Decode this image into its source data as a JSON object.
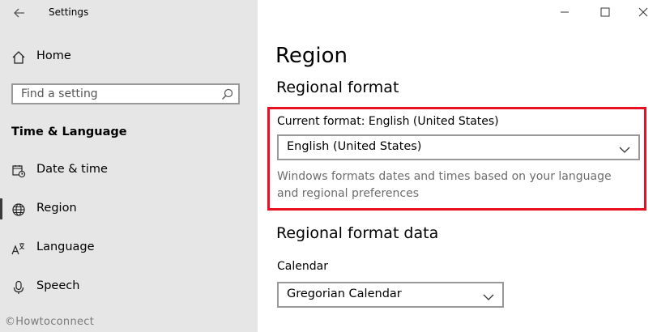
{
  "window": {
    "title": "Settings"
  },
  "sidebar": {
    "home_label": "Home",
    "search_placeholder": "Find a setting",
    "section_title": "Time & Language",
    "items": [
      {
        "label": "Date & time",
        "icon": "calendar-clock-icon"
      },
      {
        "label": "Region",
        "icon": "globe-icon",
        "selected": true
      },
      {
        "label": "Language",
        "icon": "language-icon"
      },
      {
        "label": "Speech",
        "icon": "microphone-icon"
      }
    ]
  },
  "main": {
    "page_title": "Region",
    "regional_format": {
      "heading": "Regional format",
      "current_format_label": "Current format: English (United States)",
      "dropdown_value": "English (United States)",
      "description": "Windows formats dates and times based on your language and regional preferences"
    },
    "regional_format_data": {
      "heading": "Regional format data",
      "calendar_label": "Calendar",
      "calendar_value": "Gregorian Calendar"
    }
  },
  "watermark": "©Howtoconnect",
  "colors": {
    "sidebar_bg": "#e6e6e6",
    "highlight": "#e81123",
    "muted_text": "#6d6d6d"
  }
}
